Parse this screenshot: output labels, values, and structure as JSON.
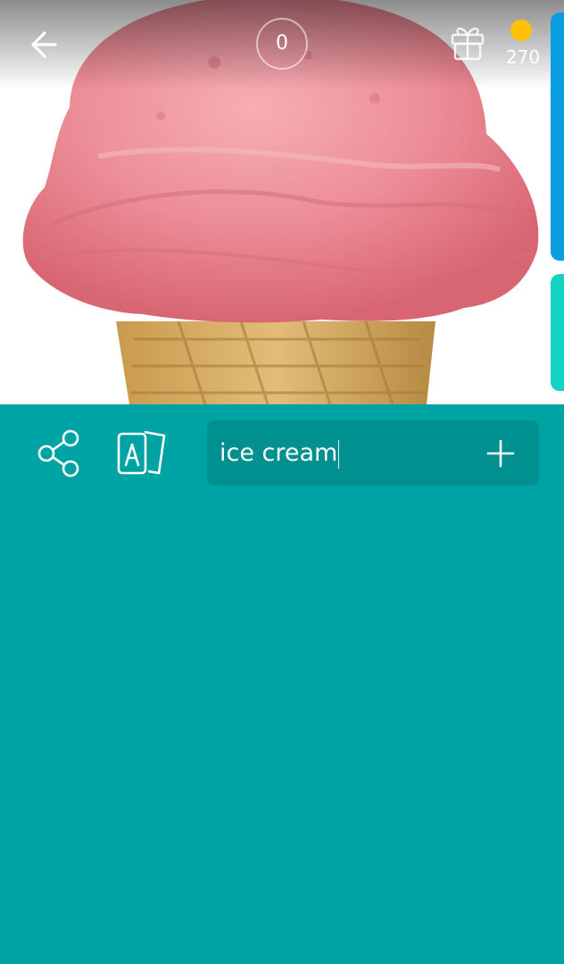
{
  "header": {
    "back_icon": "arrow-left-icon",
    "score": "0",
    "gift_icon": "gift-icon",
    "coin_icon": "coin-icon",
    "coins": "270",
    "coin_color": "#ffc107"
  },
  "image": {
    "subject_icon": "ice-cream-cone-photo"
  },
  "side_tabs": {
    "top_color": "#0a9de0",
    "bottom_color": "#12d2c3"
  },
  "toolbar": {
    "share_icon": "share-icon",
    "cards_icon": "letter-cards-icon"
  },
  "guess": {
    "value": "ice cream",
    "add_icon": "plus-icon"
  },
  "theme": {
    "background": "#00a3a3",
    "input_background": "#00908f"
  }
}
